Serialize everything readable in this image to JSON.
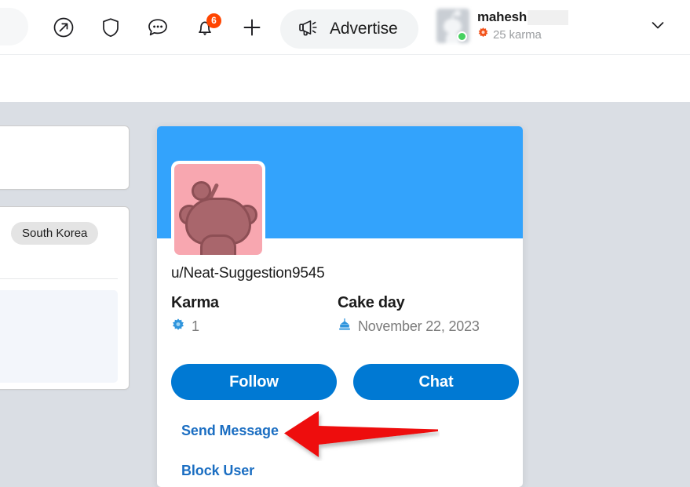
{
  "header": {
    "nav_icons": [
      {
        "name": "popout-icon",
        "label": "Open in new tab"
      },
      {
        "name": "shield-icon",
        "label": "Mod"
      },
      {
        "name": "chat-icon",
        "label": "Chat"
      },
      {
        "name": "bell-icon",
        "label": "Notifications"
      },
      {
        "name": "plus-icon",
        "label": "Create"
      }
    ],
    "notification_badge": "6",
    "advertise": {
      "label": "Advertise",
      "icon": "megaphone-icon"
    },
    "user": {
      "name": "mahesh",
      "name_redacted": true,
      "karma": "25 karma",
      "karma_icon": "karma-flower-icon",
      "avatar_icon": "snoo-avatar",
      "online": true,
      "chevron_icon": "chevron-down-icon"
    }
  },
  "sidebar": {
    "tag": "South Korea"
  },
  "profile_card": {
    "banner_color": "#33a3fc",
    "avatar": {
      "name": "snoo-avatar-large",
      "background_color": "#f8a7b0",
      "figure_color": "#a9666c"
    },
    "username": "u/Neat-Suggestion9545",
    "stats": [
      {
        "title": "Karma",
        "value": "1",
        "icon": "karma-flower-icon"
      },
      {
        "title": "Cake day",
        "value": "November 22, 2023",
        "icon": "cake-slice-icon"
      }
    ],
    "buttons": [
      {
        "name": "follow-button",
        "label": "Follow"
      },
      {
        "name": "chat-button",
        "label": "Chat"
      }
    ],
    "links": [
      {
        "name": "send-message-link",
        "label": "Send Message"
      },
      {
        "name": "block-user-link",
        "label": "Block User"
      }
    ],
    "accent_color": "#0079d3",
    "link_color": "#1b6ec2"
  },
  "annotation": {
    "arrow_color": "#ee1111",
    "points_to": "Send Message"
  }
}
